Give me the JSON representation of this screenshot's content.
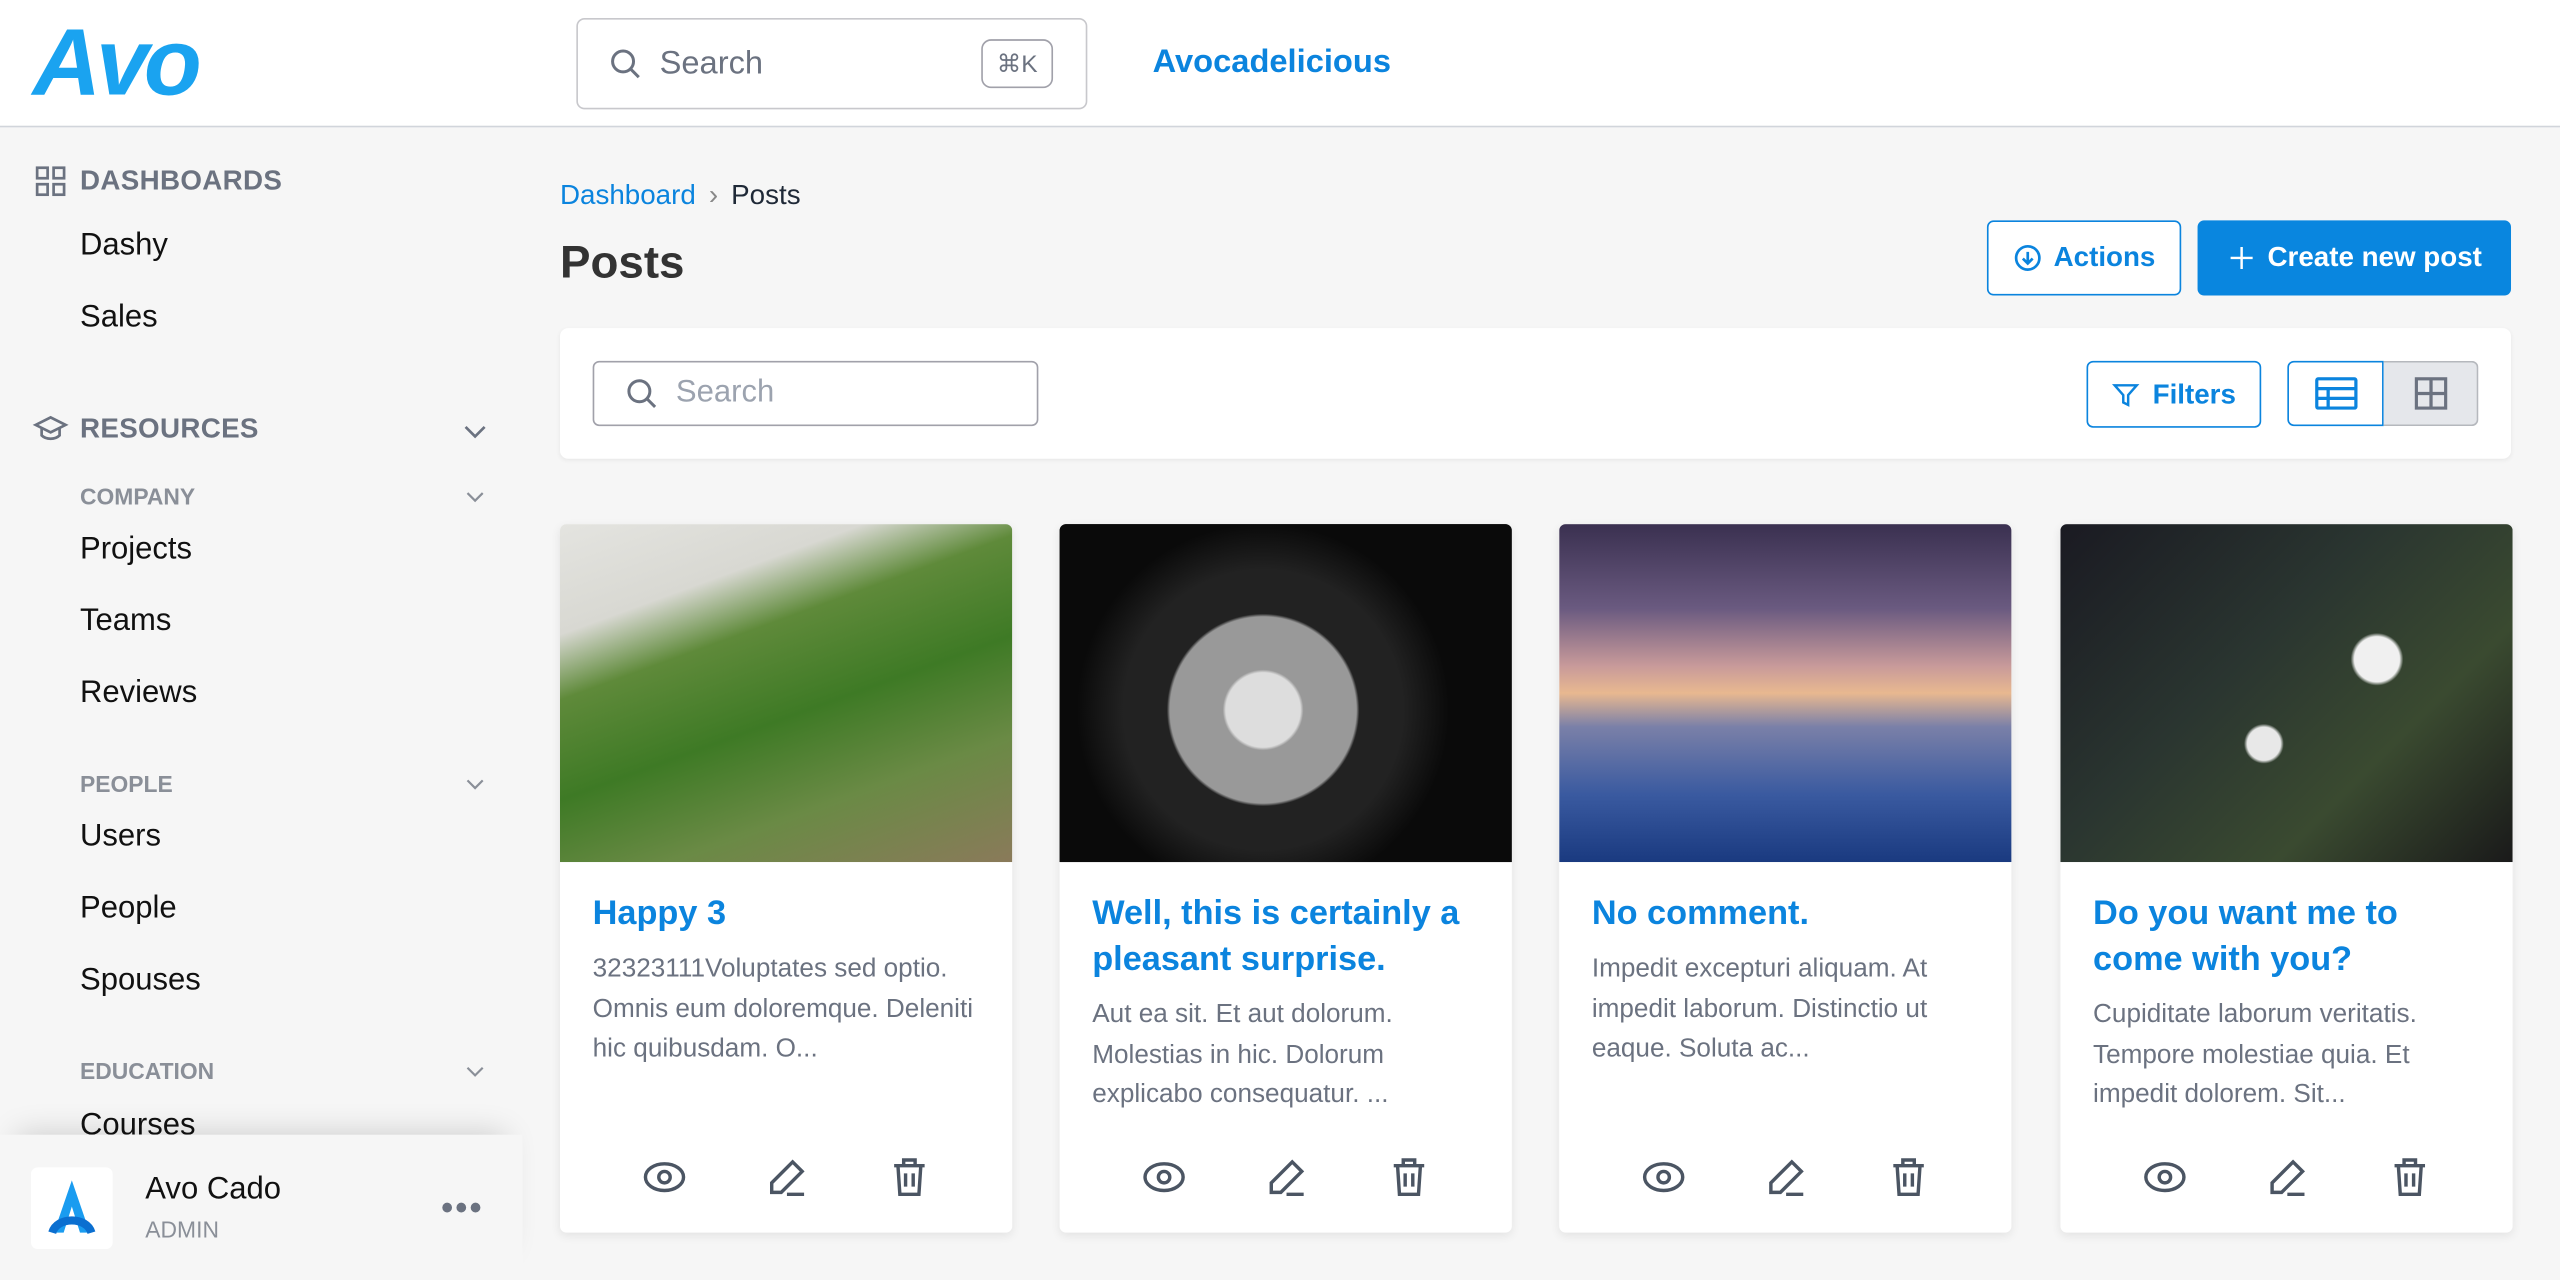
{
  "header": {
    "logo": "Avo",
    "search_placeholder": "Search",
    "shortcut": "⌘K",
    "brand_link": "Avocadelicious"
  },
  "sidebar": {
    "dashboards_heading": "DASHBOARDS",
    "dashboards": [
      "Dashy",
      "Sales"
    ],
    "resources_heading": "RESOURCES",
    "groups": [
      {
        "label": "COMPANY",
        "items": [
          "Projects",
          "Teams",
          "Reviews"
        ]
      },
      {
        "label": "PEOPLE",
        "items": [
          "Users",
          "People",
          "Spouses"
        ]
      },
      {
        "label": "EDUCATION",
        "items": [
          "Courses"
        ]
      }
    ],
    "user": {
      "name": "Avo Cado",
      "role": "ADMIN"
    }
  },
  "breadcrumb": {
    "parent": "Dashboard",
    "current": "Posts"
  },
  "page": {
    "title": "Posts",
    "actions_label": "Actions",
    "create_label": "Create new post"
  },
  "toolbar": {
    "search_placeholder": "Search",
    "filters_label": "Filters",
    "view_mode": "grid"
  },
  "colors": {
    "accent": "#0b84de",
    "background": "#f6f6f6"
  },
  "cards": [
    {
      "title": "Happy 3",
      "excerpt": "32323111Voluptates sed optio. Omnis eum doloremque. Deleniti hic quibusdam. O..."
    },
    {
      "title": "Well, this is certainly a pleasant surprise.",
      "excerpt": "Aut ea sit. Et aut dolorum. Molestias in hic. Dolorum explicabo consequatur. ..."
    },
    {
      "title": "No comment.",
      "excerpt": "Impedit excepturi aliquam. At impedit laborum. Distinctio ut eaque. Soluta ac..."
    },
    {
      "title": "Do you want me to come with you?",
      "excerpt": "Cupiditate laborum veritatis. Tempore molestiae quia. Et impedit dolorem. Sit..."
    }
  ]
}
